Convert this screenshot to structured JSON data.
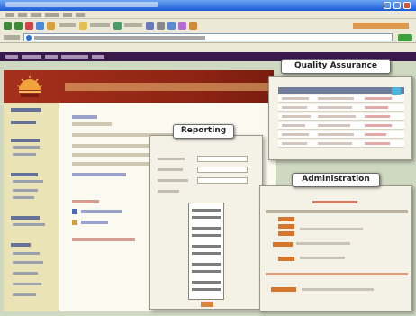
{
  "browser": {
    "title": "",
    "address_label": "",
    "url": "",
    "brand": ""
  },
  "app": {
    "title": "",
    "colors": {
      "banner": "#a5301c",
      "nav": "#3a1a4c",
      "sidebar": "#e9e3b6",
      "accent": "#d4772c"
    }
  },
  "callouts": {
    "quality_assurance": "Quality Assurance",
    "reporting": "Reporting",
    "administration": "Administration"
  },
  "icons": {
    "logo": "sunrise-logo-icon",
    "address": "ie-page-icon",
    "go": "go-arrow-icon",
    "window_controls": [
      "minimize-icon",
      "maximize-icon",
      "close-icon"
    ]
  }
}
